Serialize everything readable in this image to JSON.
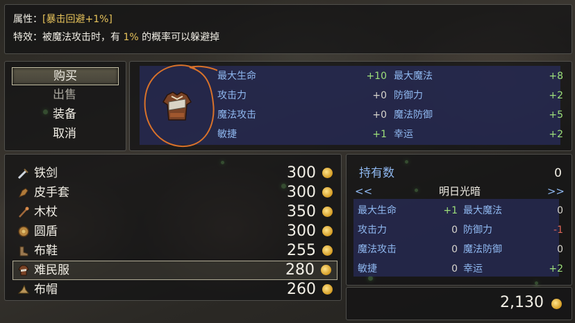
{
  "help": {
    "attr_label": "属性：",
    "attr_value": "[暴击回避+1%]",
    "effect_label": "特效：",
    "effect_pre": "被魔法攻击时，有 ",
    "effect_pct": "1%",
    "effect_post": " 的概率可以躲避掉"
  },
  "commands": [
    {
      "label": "购买",
      "selected": true
    },
    {
      "label": "出售",
      "enabled": false
    },
    {
      "label": "装备"
    },
    {
      "label": "取消"
    }
  ],
  "preview": {
    "icon": "tunic-armor-icon",
    "stats": [
      {
        "label": "最大生命",
        "value": "+10"
      },
      {
        "label": "最大魔法",
        "value": "+8"
      },
      {
        "label": "攻击力",
        "value": "+0"
      },
      {
        "label": "防御力",
        "value": "+2"
      },
      {
        "label": "魔法攻击",
        "value": "+0"
      },
      {
        "label": "魔法防御",
        "value": "+5"
      },
      {
        "label": "敏捷",
        "value": "+1"
      },
      {
        "label": "幸运",
        "value": "+2"
      }
    ]
  },
  "shop_items": [
    {
      "name": "铁剑",
      "price": "300",
      "icon": "sword-icon"
    },
    {
      "name": "皮手套",
      "price": "300",
      "icon": "glove-icon"
    },
    {
      "name": "木杖",
      "price": "350",
      "icon": "staff-icon"
    },
    {
      "name": "圆盾",
      "price": "300",
      "icon": "round-shield-icon"
    },
    {
      "name": "布鞋",
      "price": "255",
      "icon": "boots-icon"
    },
    {
      "name": "难民服",
      "price": "280",
      "icon": "tunic-armor-icon",
      "selected": true
    },
    {
      "name": "布帽",
      "price": "260",
      "icon": "hat-icon"
    }
  ],
  "detail": {
    "owned_label": "持有数",
    "owned_value": "0",
    "prev_arrow": "<<",
    "next_arrow": ">>",
    "actor_name": "明日光暗",
    "stats": [
      {
        "label": "最大生命",
        "value": "+1"
      },
      {
        "label": "最大魔法",
        "value": "0"
      },
      {
        "label": "攻击力",
        "value": "0"
      },
      {
        "label": "防御力",
        "value": "-1"
      },
      {
        "label": "魔法攻击",
        "value": "0"
      },
      {
        "label": "魔法防御",
        "value": "0"
      },
      {
        "label": "敏捷",
        "value": "0"
      },
      {
        "label": "幸运",
        "value": "+2"
      }
    ]
  },
  "gold": {
    "amount": "2,130",
    "icon": "gold-coin-icon"
  },
  "colors": {
    "highlight": "#e6c25a",
    "stat_label": "#8fb8f0",
    "positive": "#9de07a",
    "negative": "#e0665a",
    "stat_bg": "#282c5a"
  }
}
